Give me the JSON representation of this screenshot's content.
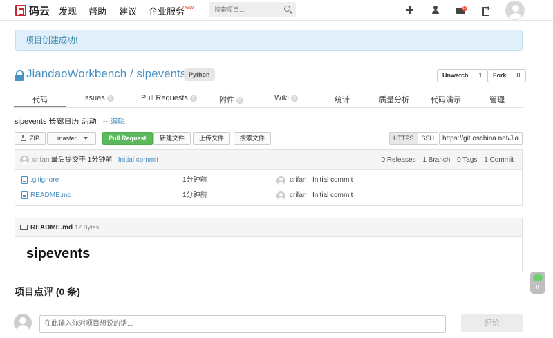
{
  "nav": {
    "logo_text": "码云",
    "links": [
      "发现",
      "帮助",
      "建议",
      "企业服务"
    ],
    "new_badge": "new",
    "search_placeholder": "搜索项目...",
    "mail_count": "10"
  },
  "alert": {
    "text": "项目创建成功!"
  },
  "repo": {
    "title": "JiandaoWorkbench / sipevents",
    "language": "Python",
    "unwatch_label": "Unwatch",
    "unwatch_count": "1",
    "fork_label": "Fork",
    "fork_count": "0"
  },
  "tabs": [
    {
      "label": "代码",
      "count": null
    },
    {
      "label": "Issues",
      "count": "0"
    },
    {
      "label": "Pull Requests",
      "count": "0"
    },
    {
      "label": "附件",
      "count": "0"
    },
    {
      "label": "Wiki",
      "count": "0"
    },
    {
      "label": "统计",
      "count": null
    },
    {
      "label": "质量分析",
      "count": null
    },
    {
      "label": "代码演示",
      "count": null
    },
    {
      "label": "管理",
      "count": null
    }
  ],
  "description": {
    "text": "sipevents 长廊日历 活动",
    "dash": "--",
    "edit_label": "编辑"
  },
  "toolbar": {
    "zip_label": "ZIP",
    "branch": "master",
    "pull_request_label": "Pull Request",
    "new_file_label": "新建文件",
    "upload_label": "上传文件",
    "search_label": "搜索文件",
    "https_label": "HTTPS",
    "ssh_label": "SSH",
    "clone_url": "https://git.oschina.net/JiandaoWorkbench/sipevents.git"
  },
  "commit": {
    "author": "crifan",
    "message": "最后提交于 1分钟前 .",
    "link": "Initial commit",
    "releases": "0 Releases",
    "branches": "1 Branch",
    "tags": "0 Tags",
    "commits": "1 Commit"
  },
  "files": [
    {
      "name": ".gitignore",
      "time": "1分钟前",
      "author": "crifan",
      "message": "Initial commit"
    },
    {
      "name": "README.md",
      "time": "1分钟前",
      "author": "crifan",
      "message": "Initial commit"
    }
  ],
  "readme": {
    "name": "README.md",
    "size": "12 Bytes",
    "heading": "sipevents"
  },
  "comments": {
    "title": "项目点评 (0 条)",
    "placeholder": "在此输入你对项目想说的话...",
    "submit_label": "评论"
  },
  "float_widget": {
    "count": "0"
  }
}
